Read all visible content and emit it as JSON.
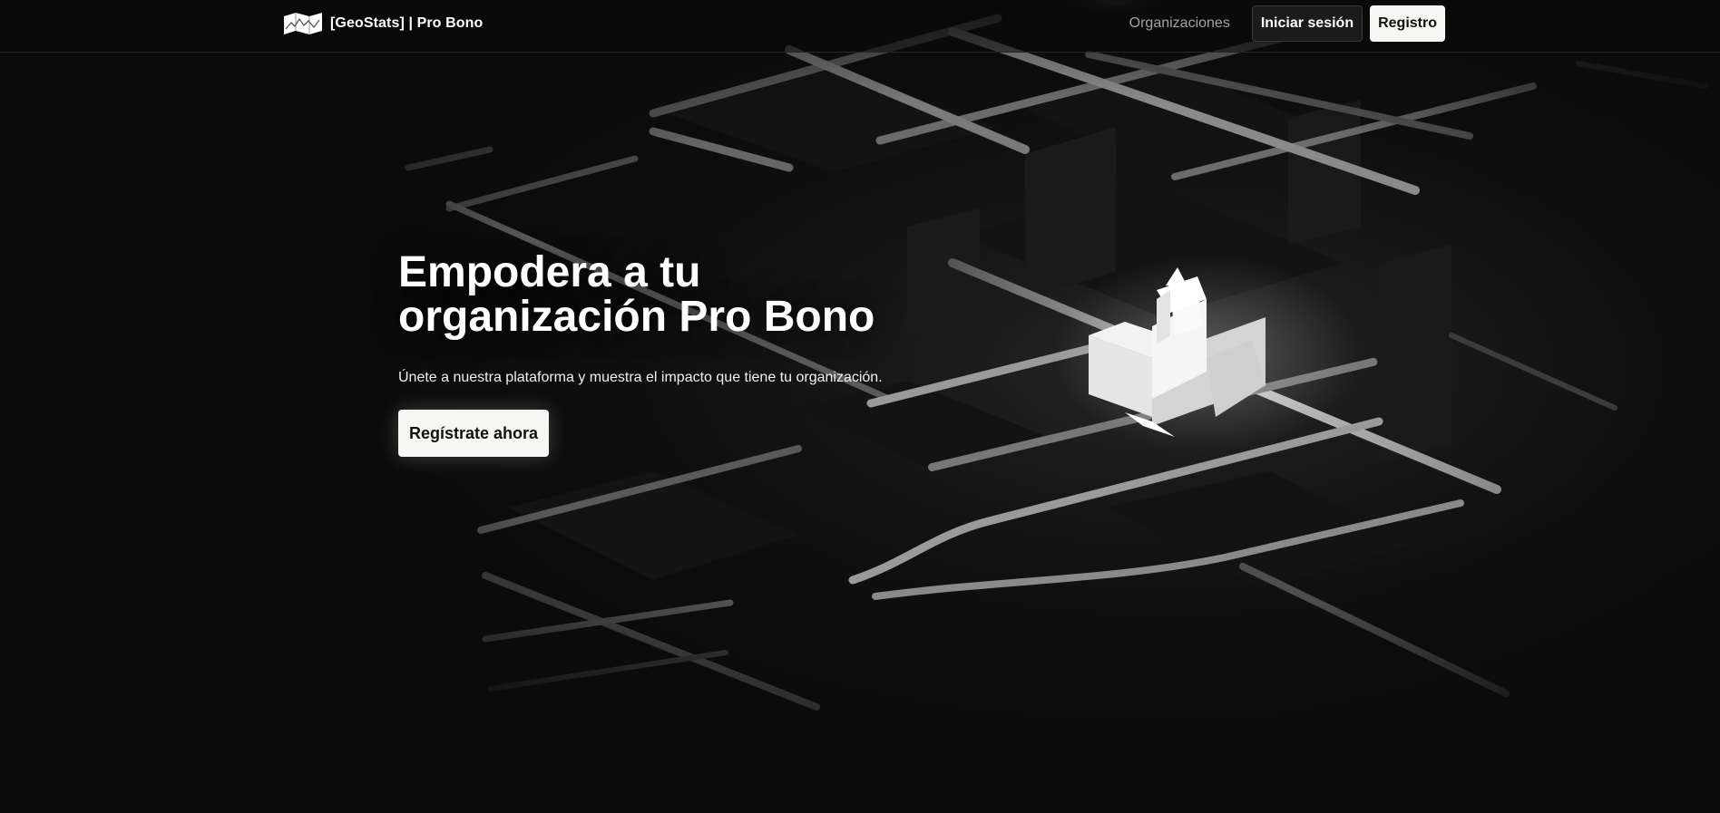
{
  "navbar": {
    "brand_text": "[GeoStats] | Pro Bono",
    "organizations_link": "Organizaciones",
    "login_button": "Iniciar sesión",
    "register_button": "Registro"
  },
  "hero": {
    "title_line1": "Empodera a tu",
    "title_line2": "organización Pro Bono",
    "subtitle": "Únete a nuestra plataforma y muestra el impacto que tiene tu organización.",
    "cta_button": "Regístrate ahora"
  },
  "colors": {
    "background": "#0c0b0b",
    "button_light": "#f7f6f2",
    "button_dark": "#1c1b1b",
    "nav_link": "#a3a3a3"
  },
  "icons": {
    "brand": "map-icon",
    "illustration": "isometric-city-map"
  }
}
